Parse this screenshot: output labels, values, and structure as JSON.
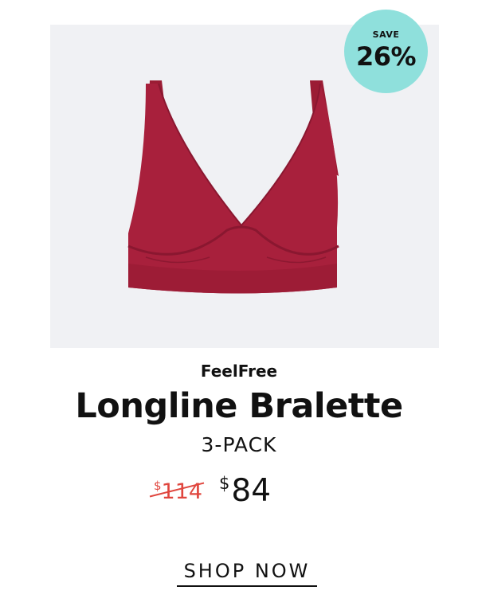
{
  "badge": {
    "label": "SAVE",
    "value": "26%",
    "color": "#8fe0dc"
  },
  "product": {
    "image": "red bralette",
    "brand": "FeelFree",
    "title": "Longline Bralette",
    "pack": "3-PACK",
    "product_color": "#a8203c"
  },
  "price": {
    "currency_symbol": "$",
    "original": "114",
    "sale": "84",
    "original_color": "#e0463e"
  },
  "cta": {
    "label": "SHOP NOW"
  }
}
